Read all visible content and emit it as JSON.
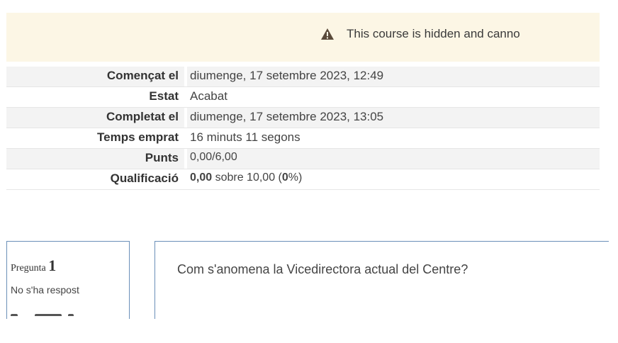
{
  "banner": {
    "message": "This course is hidden and canno",
    "icon": "warning-triangle-icon",
    "background": "#fcf6e5"
  },
  "summary": {
    "rows": [
      {
        "label": "Començat el",
        "value": "diumenge, 17 setembre 2023, 12:49"
      },
      {
        "label": "Estat",
        "value": "Acabat"
      },
      {
        "label": "Completat el",
        "value": "diumenge, 17 setembre 2023, 13:05"
      },
      {
        "label": "Temps emprat",
        "value": "16 minuts 11 segons"
      },
      {
        "label": "Punts",
        "value": "0,00/6,00"
      },
      {
        "label": "Qualificació",
        "value_bold": "0,00",
        "value_mid": " sobre 10,00 (",
        "value_pct": "0",
        "value_end": "%)"
      }
    ]
  },
  "question": {
    "label": "Pregunta",
    "number": "1",
    "state": "No s'ha respost",
    "text": "Com s'anomena la Vicedirectora actual del Centre?"
  }
}
